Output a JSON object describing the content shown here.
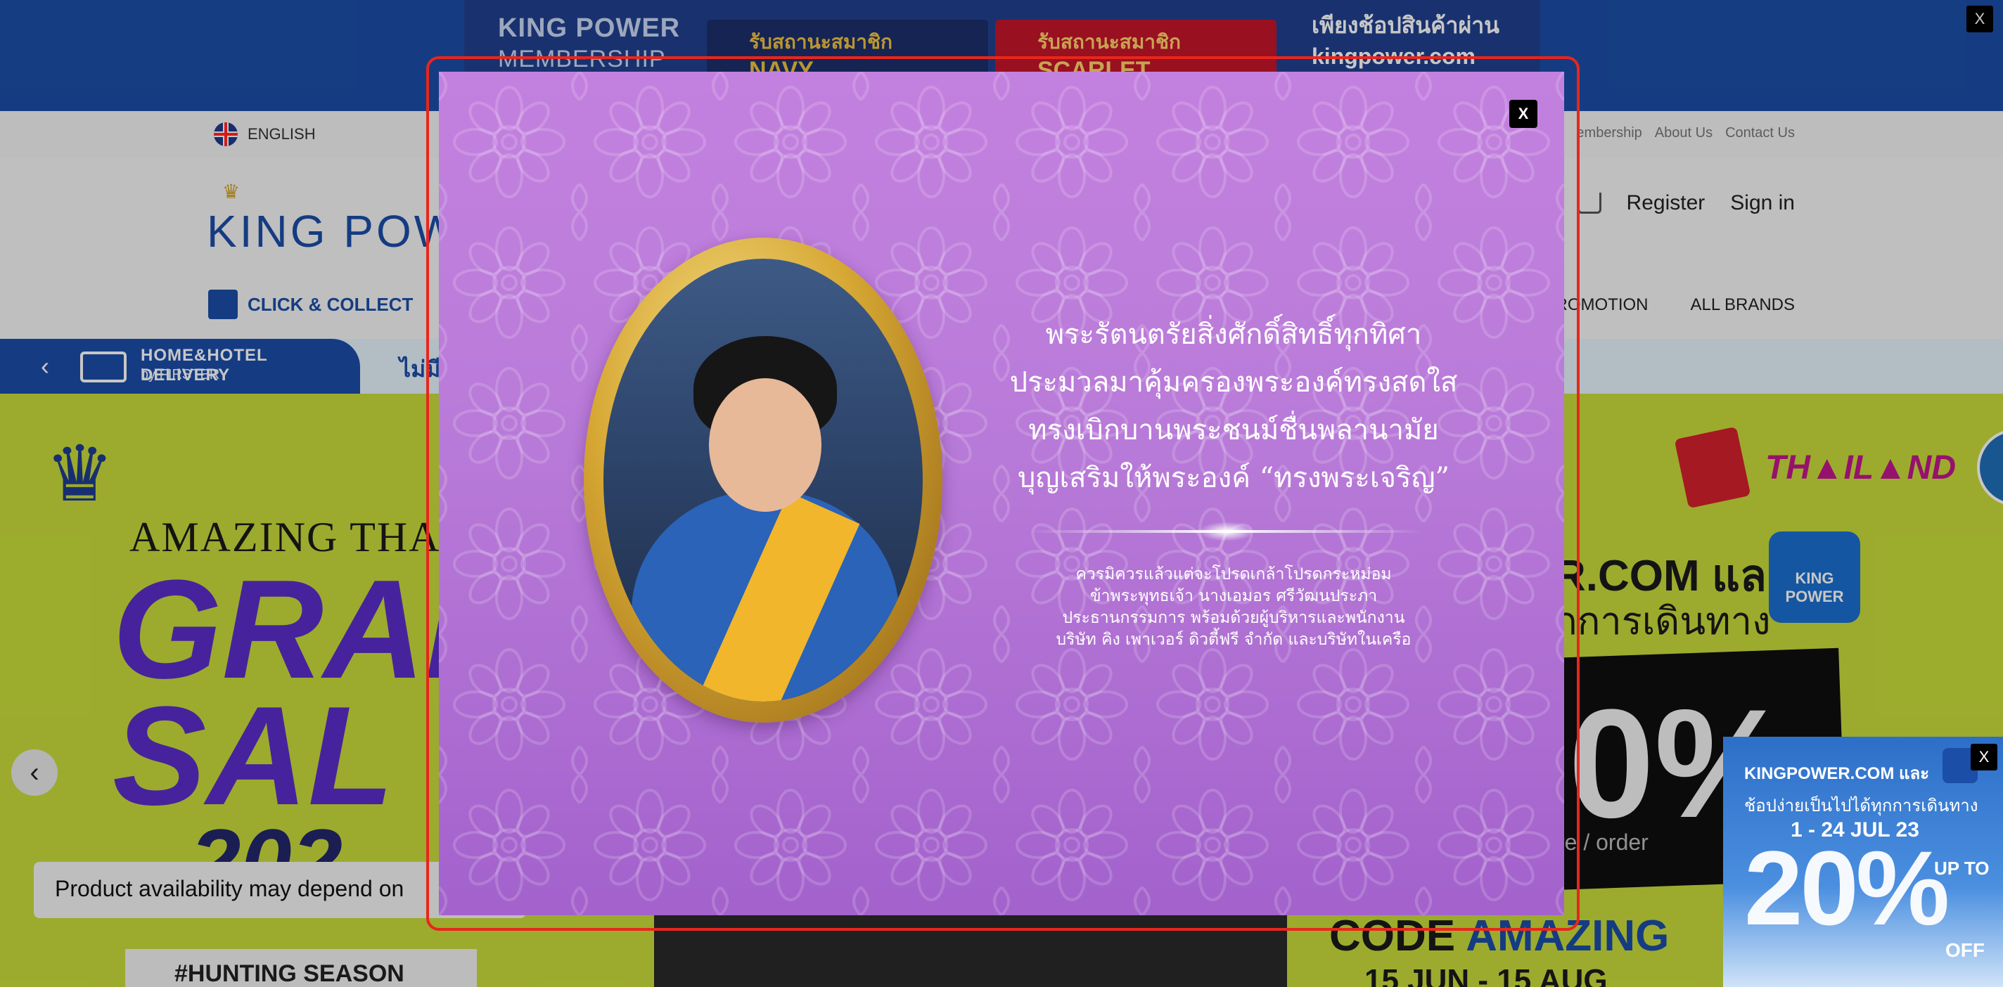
{
  "top_banner": {
    "brand_line1": "KING POWER",
    "brand_line2": "MEMBERSHIP",
    "navy_label": "รับสถานะสมาชิก",
    "navy_tier": "NAVY",
    "scarlet_label": "รับสถานะสมาชิก",
    "scarlet_tier": "SCARLET",
    "right_line1": "เพียงช้อปสินค้าผ่าน",
    "right_line2": "kingpower.com",
    "close_label": "X"
  },
  "utility_bar": {
    "language": "ENGLISH",
    "links": [
      "embership",
      "About Us",
      "Contact Us"
    ]
  },
  "header": {
    "logo_text": "KING POWE",
    "register": "Register",
    "sign_in": "Sign in"
  },
  "nav": {
    "click_collect": "CLICK & COLLECT",
    "promotion": "ROMOTION",
    "all_brands": "ALL BRANDS"
  },
  "delivery": {
    "title": "HOME&HOTEL DELIVERY",
    "subtitle": "by FIRSTER",
    "strip_text": "ไม่มี"
  },
  "hero": {
    "amazing": "AMAZING THAI",
    "grand": "GRAN",
    "sale": "SAL",
    "year": "202",
    "hunting": "#HUNTING SEASON",
    "thailand_logo": "TH▲IL▲ND",
    "com_line1": "R.COM และ",
    "com_line2": "ุกการเดินทาง",
    "kp_square": "KING POWER",
    "percent": "0%",
    "more": "r more / order",
    "code_prefix": "CODE ",
    "code_value": "AMAZING",
    "date": "15 JUN - 15 AUG",
    "availability": "Product availability may depend on"
  },
  "corner_promo": {
    "title": "KINGPOWER.COM และ",
    "line2": "ช้อปง่ายเป็นไปได้ทุกการเดินทาง",
    "dates": "1 - 24 JUL 23",
    "big": "20%",
    "up_to": "UP TO",
    "off": "OFF",
    "close_label": "X"
  },
  "modal": {
    "close_label": "X",
    "poem_lines": [
      "พระรัตนตรัยสิ่งศักดิ์สิทธิ์ทุกทิศา",
      "ประมวลมาคุ้มครองพระองค์ทรงสดใส",
      "ทรงเบิกบานพระชนม์ชื่นพลานามัย",
      "บุญเสริมให้พระองค์ “ทรงพระเจริญ”"
    ],
    "tribute_lines": [
      "ควรมิควรแล้วแต่จะโปรดเกล้าโปรดกระหม่อม",
      "ข้าพระพุทธเจ้า  นางเอมอร ศรีวัฒนประภา",
      "ประธานกรรมการ  พร้อมด้วยผู้บริหารและพนักงาน",
      "บริษัท คิง เพาเวอร์ ดิวตี้ฟรี จำกัด และบริษัทในเครือ"
    ],
    "colors": {
      "background": "#b87ad8",
      "highlight_border": "#e8261c"
    }
  }
}
